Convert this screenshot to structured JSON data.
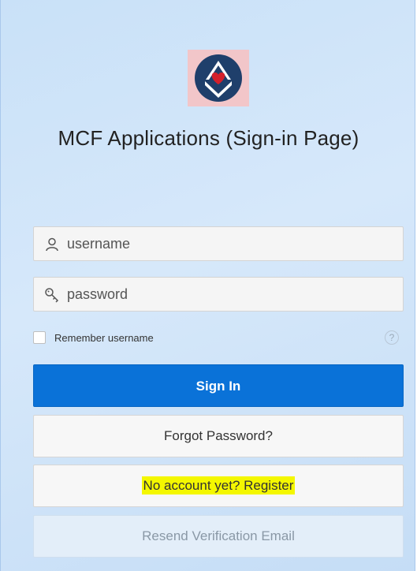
{
  "app": {
    "title": "MCF Applications (Sign-in Page)"
  },
  "logo": {
    "icon": "masonic-square-heart-logo",
    "colors": {
      "background": "#f2c6c9",
      "circle": "#1f3f6b",
      "heart": "#d4202b"
    }
  },
  "form": {
    "username": {
      "icon": "user-icon",
      "placeholder": "username",
      "value": ""
    },
    "password": {
      "icon": "key-icon",
      "placeholder": "password",
      "value": ""
    },
    "remember": {
      "label": "Remember username",
      "checked": false
    },
    "help_icon": "?"
  },
  "buttons": {
    "sign_in": "Sign In",
    "forgot": "Forgot Password?",
    "register": "No account yet? Register",
    "resend": "Resend Verification Email"
  },
  "colors": {
    "primary": "#0a72d8",
    "highlight": "#f4f700"
  }
}
